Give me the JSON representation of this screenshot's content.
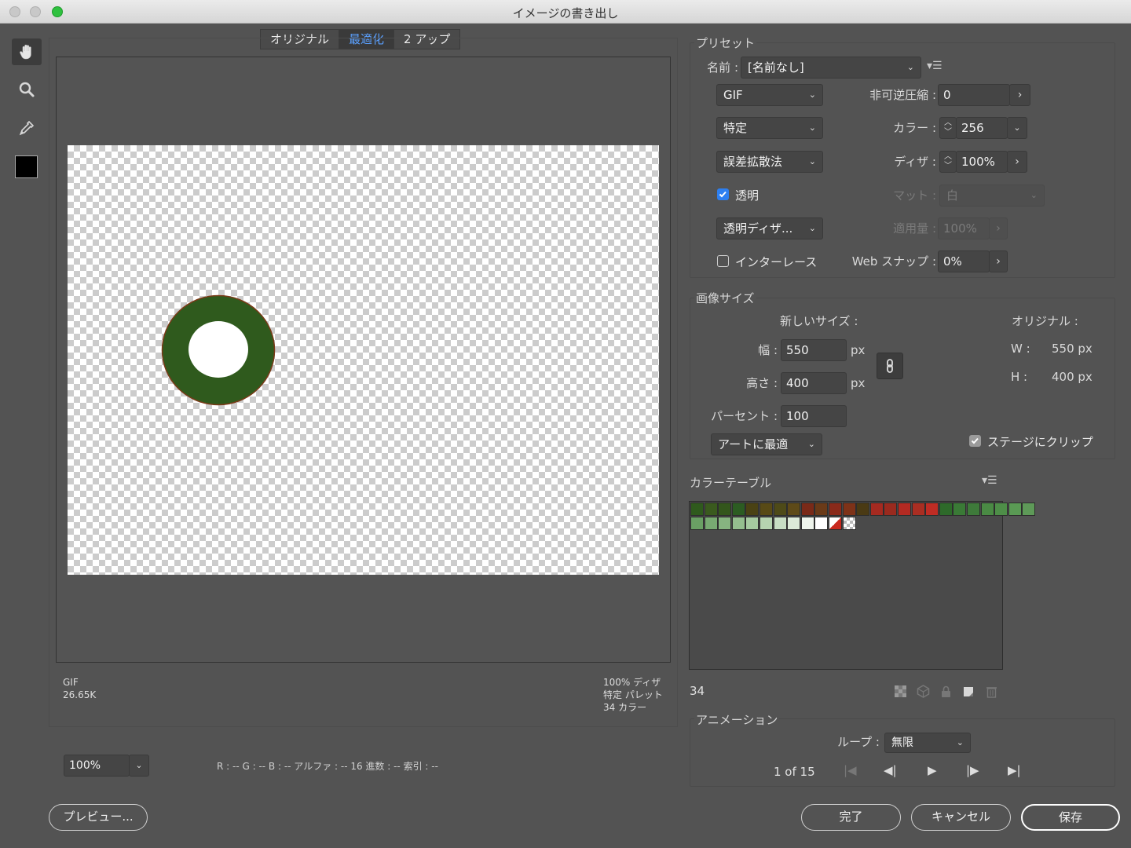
{
  "window": {
    "title": "イメージの書き出し"
  },
  "tools": [
    "hand-icon",
    "zoom-icon",
    "eyedropper-icon",
    "color-swatch"
  ],
  "view_tabs": [
    {
      "label": "オリジナル",
      "active": false
    },
    {
      "label": "最適化",
      "active": true
    },
    {
      "label": "2 アップ",
      "active": false
    }
  ],
  "preview_info": {
    "format": "GIF",
    "size": "26.65K",
    "dither": "100% ディザ",
    "palette": "特定 パレット",
    "colors": "34 カラー"
  },
  "zoom": {
    "value": "100%"
  },
  "status_bar": "R : -- G : -- B : -- アルファ : -- 16 進数 : -- 索引 : --",
  "preset": {
    "section_title": "プリセット",
    "name_label": "名前 :",
    "name_value": "[名前なし]",
    "format": "GIF",
    "palette": "特定",
    "dither_method": "誤差拡散法",
    "transparency_label": "透明",
    "transparency_checked": true,
    "transparency_dither": "透明ディザ...",
    "interlace_label": "インターレース",
    "interlace_checked": false,
    "lossy_label": "非可逆圧縮 :",
    "lossy_value": "0",
    "colors_label": "カラー :",
    "colors_value": "256",
    "dither_label": "ディザ :",
    "dither_value": "100%",
    "matte_label": "マット :",
    "matte_value": "白",
    "amount_label": "適用量 :",
    "amount_value": "100%",
    "websnap_label": "Web スナップ :",
    "websnap_value": "0%"
  },
  "image_size": {
    "section_title": "画像サイズ",
    "new_size_label": "新しいサイズ :",
    "original_label": "オリジナル :",
    "width_label": "幅 :",
    "width_value": "550",
    "height_label": "高さ :",
    "height_value": "400",
    "percent_label": "パーセント :",
    "percent_value": "100",
    "unit": "px",
    "orig_w_label": "W :",
    "orig_w_value": "550 px",
    "orig_h_label": "H :",
    "orig_h_value": "400 px",
    "fit": "アートに最適",
    "clip_label": "ステージにクリップ",
    "clip_checked": true
  },
  "color_table": {
    "section_title": "カラーテーブル",
    "count": "34",
    "row1": [
      "#2f5a1d",
      "#3a5a1e",
      "#33561c",
      "#2c5c22",
      "#4a4214",
      "#584a16",
      "#4e4a18",
      "#5e4a18",
      "#7a2a18",
      "#6a3a18",
      "#8a2a1a",
      "#7e3218",
      "#4a3a14",
      "#a52a20",
      "#9a2a1e",
      "#b32a22",
      "#aa2e22",
      "#c02c24",
      "#2e6a2a",
      "#3a7a36",
      "#3e7a3a",
      "#4a8a44",
      "#4e8e48",
      "#5a9a54",
      "#5e9a58"
    ],
    "row2": [
      "#6aa064",
      "#78aa72",
      "#86b480",
      "#94be8e",
      "#a6caa0",
      "#b6d4b0",
      "#c8dec4",
      "#dcead8",
      "#eef4ec",
      "#ffffff"
    ]
  },
  "animation": {
    "section_title": "アニメーション",
    "loop_label": "ループ :",
    "loop_value": "無限",
    "frame_counter": "1 of 15"
  },
  "buttons": {
    "preview": "プレビュー...",
    "done": "完了",
    "cancel": "キャンセル",
    "save": "保存"
  },
  "colors": {
    "accent": "#5aa0ff",
    "checkbox": "#2d7ff0",
    "ring": "#2f5a1d"
  }
}
